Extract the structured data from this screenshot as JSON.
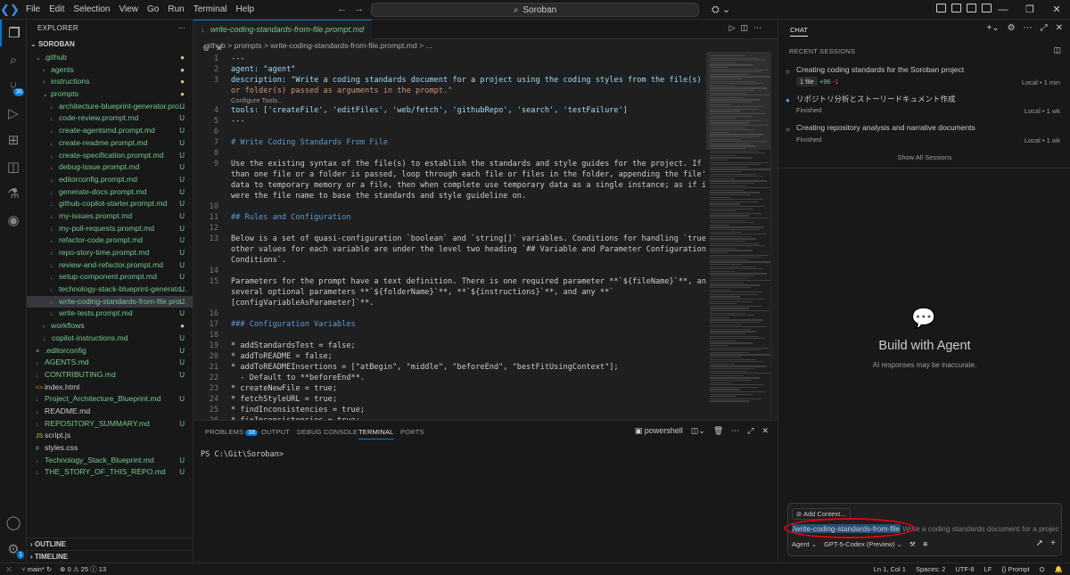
{
  "titlebar": {
    "menu": [
      "File",
      "Edit",
      "Selection",
      "View",
      "Go",
      "Run",
      "Terminal",
      "Help"
    ],
    "search": "Soroban"
  },
  "activity": {
    "source_control_badge": "36",
    "accounts_badge": "1"
  },
  "explorer": {
    "header": "EXPLORER",
    "root": "SOROBAN",
    "items": [
      {
        "name": ".github",
        "depth": 1,
        "type": "folder-open",
        "status": "●",
        "green": true
      },
      {
        "name": "agents",
        "depth": 2,
        "type": "folder",
        "status": "●",
        "green": true
      },
      {
        "name": "instructions",
        "depth": 2,
        "type": "folder",
        "status": "●",
        "green": true
      },
      {
        "name": "prompts",
        "depth": 2,
        "type": "folder-open",
        "status": "●",
        "green": true
      },
      {
        "name": "architecture-blueprint-generator.pro...",
        "depth": 3,
        "type": "md",
        "status": "U",
        "green": true
      },
      {
        "name": "code-review.prompt.md",
        "depth": 3,
        "type": "md",
        "status": "U",
        "green": true
      },
      {
        "name": "create-agentsmd.prompt.md",
        "depth": 3,
        "type": "md",
        "status": "U",
        "green": true
      },
      {
        "name": "create-readme.prompt.md",
        "depth": 3,
        "type": "md",
        "status": "U",
        "green": true
      },
      {
        "name": "create-specification.prompt.md",
        "depth": 3,
        "type": "md",
        "status": "U",
        "green": true
      },
      {
        "name": "debug-issue.prompt.md",
        "depth": 3,
        "type": "md",
        "status": "U",
        "green": true
      },
      {
        "name": "editorconfig.prompt.md",
        "depth": 3,
        "type": "md",
        "status": "U",
        "green": true
      },
      {
        "name": "generate-docs.prompt.md",
        "depth": 3,
        "type": "md",
        "status": "U",
        "green": true
      },
      {
        "name": "github-copilot-starter.prompt.md",
        "depth": 3,
        "type": "md",
        "status": "U",
        "green": true
      },
      {
        "name": "my-issues.prompt.md",
        "depth": 3,
        "type": "md",
        "status": "U",
        "green": true
      },
      {
        "name": "my-pull-requests.prompt.md",
        "depth": 3,
        "type": "md",
        "status": "U",
        "green": true
      },
      {
        "name": "refactor-code.prompt.md",
        "depth": 3,
        "type": "md",
        "status": "U",
        "green": true
      },
      {
        "name": "repo-story-time.prompt.md",
        "depth": 3,
        "type": "md",
        "status": "U",
        "green": true
      },
      {
        "name": "review-and-refactor.prompt.md",
        "depth": 3,
        "type": "md",
        "status": "U",
        "green": true
      },
      {
        "name": "setup-component.prompt.md",
        "depth": 3,
        "type": "md",
        "status": "U",
        "green": true
      },
      {
        "name": "technology-stack-blueprint-generato...",
        "depth": 3,
        "type": "md",
        "status": "U",
        "green": true
      },
      {
        "name": "write-coding-standards-from-file.pro...",
        "depth": 3,
        "type": "md",
        "status": "U",
        "green": true,
        "selected": true
      },
      {
        "name": "write-tests.prompt.md",
        "depth": 3,
        "type": "md",
        "status": "U",
        "green": true
      },
      {
        "name": "workflows",
        "depth": 2,
        "type": "folder",
        "status": "●",
        "green": true
      },
      {
        "name": "copilot-instructions.md",
        "depth": 2,
        "type": "md",
        "status": "U",
        "green": true
      },
      {
        "name": ".editorconfig",
        "depth": 1,
        "type": "cfg",
        "status": "U",
        "green": true
      },
      {
        "name": "AGENTS.md",
        "depth": 1,
        "type": "md",
        "status": "U",
        "green": true
      },
      {
        "name": "CONTRIBUTING.md",
        "depth": 1,
        "type": "md",
        "status": "U",
        "green": true
      },
      {
        "name": "index.html",
        "depth": 1,
        "type": "html",
        "status": "",
        "green": false
      },
      {
        "name": "Project_Architecture_Blueprint.md",
        "depth": 1,
        "type": "md",
        "status": "U",
        "green": true
      },
      {
        "name": "README.md",
        "depth": 1,
        "type": "md",
        "status": "",
        "green": false
      },
      {
        "name": "REPOSITORY_SUMMARY.md",
        "depth": 1,
        "type": "md",
        "status": "U",
        "green": true
      },
      {
        "name": "script.js",
        "depth": 1,
        "type": "js",
        "status": "",
        "green": false
      },
      {
        "name": "styles.css",
        "depth": 1,
        "type": "css",
        "status": "",
        "green": false
      },
      {
        "name": "Technology_Stack_Blueprint.md",
        "depth": 1,
        "type": "md",
        "status": "U",
        "green": true
      },
      {
        "name": "THE_STORY_OF_THIS_REPO.md",
        "depth": 1,
        "type": "md",
        "status": "U",
        "green": true
      }
    ],
    "outline": "OUTLINE",
    "timeline": "TIMELINE"
  },
  "editor": {
    "tab_name": "write-coding-standards-from-file.prompt.md",
    "tab_status": "U",
    "breadcrumb": ".github  >  prompts  >  write-coding-standards-from-file.prompt.md  >  ...",
    "codelens": "Configure Tools...",
    "lines": [
      {
        "n": "1",
        "t": "---"
      },
      {
        "n": "2",
        "t": "agent: \"agent\""
      },
      {
        "n": "3",
        "t": "description: \"Write a coding standards document for a project using the coding styles from the file(s) and/"
      },
      {
        "n": "",
        "t": "or folder(s) passed as arguments in the prompt.\""
      },
      {
        "n": "4",
        "t": "tools: ['createFile', 'editFiles', 'web/fetch', 'githubRepo', 'search', 'testFailure']"
      },
      {
        "n": "5",
        "t": "---"
      },
      {
        "n": "6",
        "t": ""
      },
      {
        "n": "7",
        "t": "# Write Coding Standards From File"
      },
      {
        "n": "8",
        "t": ""
      },
      {
        "n": "9",
        "t": "Use the existing syntax of the file(s) to establish the standards and style guides for the project. If more"
      },
      {
        "n": "",
        "t": "than one file or a folder is passed, loop through each file or files in the folder, appending the file's"
      },
      {
        "n": "",
        "t": "data to temporary memory or a file, then when complete use temporary data as a single instance; as if it"
      },
      {
        "n": "",
        "t": "were the file name to base the standards and style guideline on."
      },
      {
        "n": "10",
        "t": ""
      },
      {
        "n": "11",
        "t": "## Rules and Configuration"
      },
      {
        "n": "12",
        "t": ""
      },
      {
        "n": "13",
        "t": "Below is a set of quasi-configuration `boolean` and `string[]` variables. Conditions for handling `true`, or"
      },
      {
        "n": "",
        "t": "other values for each variable are under the level two heading `## Variable and Parameter Configuration"
      },
      {
        "n": "",
        "t": "Conditions`."
      },
      {
        "n": "14",
        "t": ""
      },
      {
        "n": "15",
        "t": "Parameters for the prompt have a text definition. There is one required parameter **`${fileName}`**, and"
      },
      {
        "n": "",
        "t": "several optional parameters **`${folderName}`**, **`${instructions}`**, and any **`"
      },
      {
        "n": "",
        "t": "[configVariableAsParameter]`**."
      },
      {
        "n": "16",
        "t": ""
      },
      {
        "n": "17",
        "t": "### Configuration Variables"
      },
      {
        "n": "18",
        "t": ""
      },
      {
        "n": "19",
        "t": "* addStandardsTest = false;"
      },
      {
        "n": "20",
        "t": "* addToREADME = false;"
      },
      {
        "n": "21",
        "t": "* addToREADMEInsertions = [\"atBegin\", \"middle\", \"beforeEnd\", \"bestFitUsingContext\"];"
      },
      {
        "n": "22",
        "t": "  - Default to **beforeEnd**."
      },
      {
        "n": "23",
        "t": "* createNewFile = true;"
      },
      {
        "n": "24",
        "t": "* fetchStyleURL = true;"
      },
      {
        "n": "25",
        "t": "* findInconsistencies = true;"
      },
      {
        "n": "26",
        "t": "* fixInconsistencies = true;"
      }
    ]
  },
  "panel": {
    "tabs": [
      "PROBLEMS",
      "OUTPUT",
      "DEBUG CONSOLE",
      "TERMINAL",
      "PORTS"
    ],
    "problems_count": "38",
    "shell": "powershell",
    "prompt": "PS C:\\Git\\Soroban>"
  },
  "chat": {
    "title": "CHAT",
    "recent_header": "RECENT SESSIONS",
    "sessions": [
      {
        "title": "Creating coding standards for the Soroban project",
        "sub_chip": "1 file",
        "plus": "+96",
        "minus": "-1",
        "time": "Local • 1 min",
        "dot": "○"
      },
      {
        "title": "リポジトリ分析とストーリードキュメント作成",
        "sub": "Finished",
        "time": "Local • 1 wk",
        "dot": "●"
      },
      {
        "title": "Creating repository analysis and narrative documents",
        "sub": "Finished",
        "time": "Local • 1 wk",
        "dot": "○"
      }
    ],
    "show_all": "Show All Sessions",
    "empty_title": "Build with Agent",
    "empty_sub": "AI responses may be inaccurate.",
    "add_context": "Add Context...",
    "command": "/write-coding-standards-from-file",
    "placeholder": "Write a coding standards document for a project",
    "mode": "Agent",
    "model": "GPT-5-Codex (Preview)"
  },
  "statusbar": {
    "branch": "main*",
    "errors": "0",
    "warnings": "25",
    "info": "13",
    "position": "Ln 1, Col 1",
    "spaces": "Spaces: 2",
    "encoding": "UTF-8",
    "eol": "LF",
    "language": "Prompt"
  },
  "colors": {
    "accent": "#0078d4",
    "untracked": "#73c991",
    "modified": "#e2c08d",
    "annotation": "#e3000f"
  }
}
